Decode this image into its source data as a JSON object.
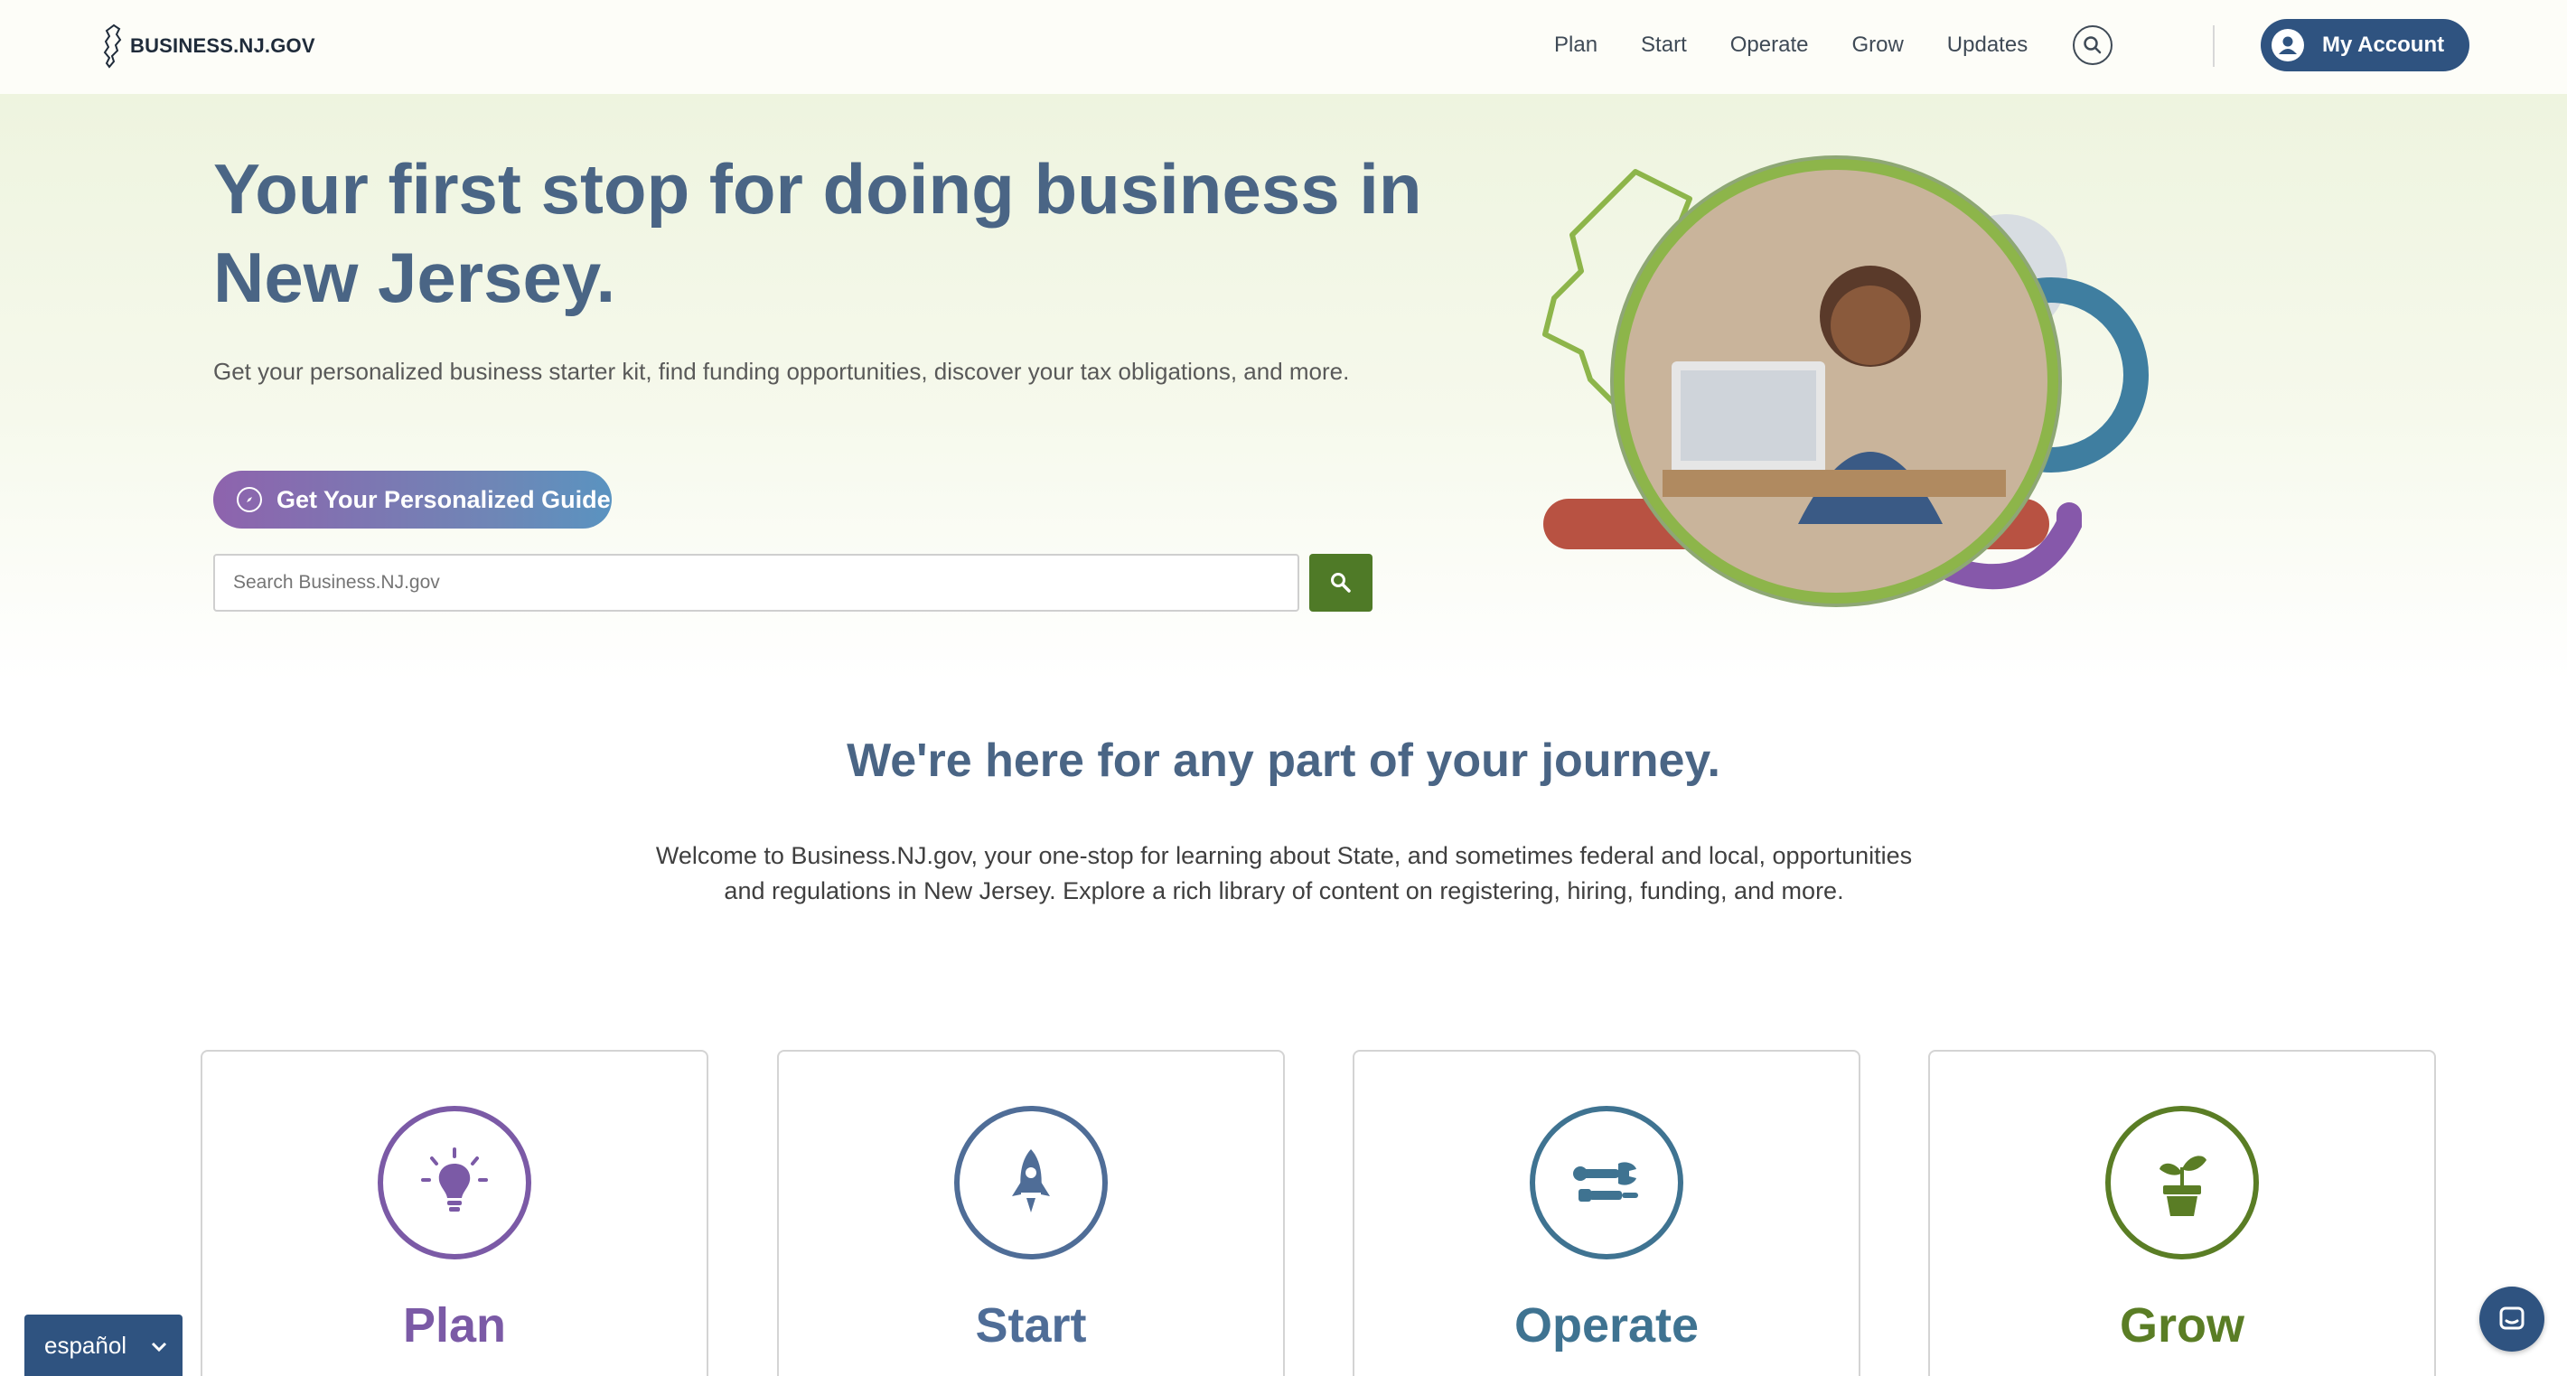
{
  "header": {
    "logo_text": "BUSINESS.NJ.GOV",
    "nav": [
      "Plan",
      "Start",
      "Operate",
      "Grow",
      "Updates"
    ],
    "search_icon": "search-icon",
    "account_label": "My Account"
  },
  "hero": {
    "title": "Your first stop for doing business in New Jersey.",
    "subtitle": "Get your personalized business starter kit, find funding opportunities, discover your tax obligations, and more.",
    "guide_button": "Get Your Personalized Guide",
    "search_placeholder": "Search Business.NJ.gov"
  },
  "journey": {
    "title": "We're here for any part of your journey.",
    "text": "Welcome to Business.NJ.gov, your one-stop for learning about State, and sometimes federal and local, opportunities and regulations in New Jersey. Explore a rich library of content on registering, hiring, funding, and more."
  },
  "cards": [
    {
      "title": "Plan",
      "icon": "lightbulb-icon",
      "color": "#7b5aa6"
    },
    {
      "title": "Start",
      "icon": "rocket-icon",
      "color": "#4f6d97"
    },
    {
      "title": "Operate",
      "icon": "tools-icon",
      "color": "#3f7391"
    },
    {
      "title": "Grow",
      "icon": "plant-icon",
      "color": "#5a7d25"
    }
  ],
  "footer_widgets": {
    "language_label": "español",
    "chat_icon": "chat-icon"
  },
  "colors": {
    "primary_navy": "#2f5380",
    "heading_blue": "#4a6585",
    "search_green": "#4f7a27"
  }
}
